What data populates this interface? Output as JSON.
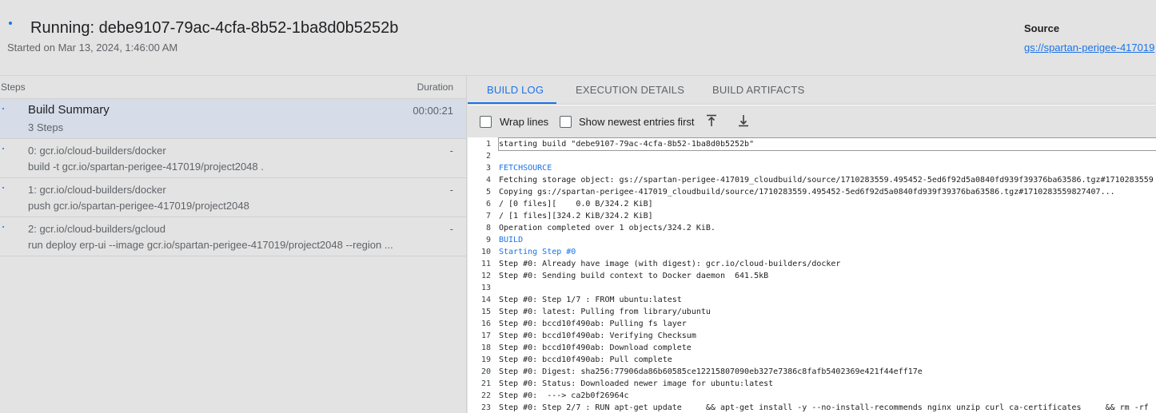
{
  "header": {
    "title": "Running: debe9107-79ac-4cfa-8b52-1ba8d0b5252b",
    "started": "Started on Mar 13, 2024, 1:46:00 AM",
    "source_label": "Source",
    "source_link": "gs://spartan-perigee-417019"
  },
  "steps": {
    "col_steps": "Steps",
    "col_duration": "Duration",
    "summary": {
      "title": "Build Summary",
      "subtitle": "3 Steps",
      "duration": "00:00:21"
    },
    "items": [
      {
        "title": "0: gcr.io/cloud-builders/docker",
        "subtitle": "build -t gcr.io/spartan-perigee-417019/project2048 .",
        "duration": "-"
      },
      {
        "title": "1: gcr.io/cloud-builders/docker",
        "subtitle": "push gcr.io/spartan-perigee-417019/project2048",
        "duration": "-"
      },
      {
        "title": "2: gcr.io/cloud-builders/gcloud",
        "subtitle": "run deploy erp-ui --image gcr.io/spartan-perigee-417019/project2048 --region ...",
        "duration": "-"
      }
    ]
  },
  "tabs": [
    {
      "label": "BUILD LOG",
      "active": true
    },
    {
      "label": "EXECUTION DETAILS",
      "active": false
    },
    {
      "label": "BUILD ARTIFACTS",
      "active": false
    }
  ],
  "toolbar": {
    "wrap_lines": "Wrap lines",
    "show_newest": "Show newest entries first",
    "scroll_top_icon": "scroll-to-top-icon",
    "scroll_bottom_icon": "scroll-to-bottom-icon"
  },
  "accent_color": "#1a73e8",
  "log_lines": [
    {
      "n": "1",
      "t": "starting build \"debe9107-79ac-4cfa-8b52-1ba8d0b5252b\""
    },
    {
      "n": "2",
      "t": ""
    },
    {
      "n": "3",
      "t": "FETCHSOURCE",
      "hl": true
    },
    {
      "n": "4",
      "t": "Fetching storage object: gs://spartan-perigee-417019_cloudbuild/source/1710283559.495452-5ed6f92d5a0840fd939f39376ba63586.tgz#1710283559"
    },
    {
      "n": "5",
      "t": "Copying gs://spartan-perigee-417019_cloudbuild/source/1710283559.495452-5ed6f92d5a0840fd939f39376ba63586.tgz#1710283559827407..."
    },
    {
      "n": "6",
      "t": "/ [0 files][    0.0 B/324.2 KiB]"
    },
    {
      "n": "7",
      "t": "/ [1 files][324.2 KiB/324.2 KiB]"
    },
    {
      "n": "8",
      "t": "Operation completed over 1 objects/324.2 KiB."
    },
    {
      "n": "9",
      "t": "BUILD",
      "hl": true
    },
    {
      "n": "10",
      "t": "Starting Step #0",
      "hl": true
    },
    {
      "n": "11",
      "t": "Step #0: Already have image (with digest): gcr.io/cloud-builders/docker"
    },
    {
      "n": "12",
      "t": "Step #0: Sending build context to Docker daemon  641.5kB"
    },
    {
      "n": "13",
      "t": ""
    },
    {
      "n": "14",
      "t": "Step #0: Step 1/7 : FROM ubuntu:latest"
    },
    {
      "n": "15",
      "t": "Step #0: latest: Pulling from library/ubuntu"
    },
    {
      "n": "16",
      "t": "Step #0: bccd10f490ab: Pulling fs layer"
    },
    {
      "n": "17",
      "t": "Step #0: bccd10f490ab: Verifying Checksum"
    },
    {
      "n": "18",
      "t": "Step #0: bccd10f490ab: Download complete"
    },
    {
      "n": "19",
      "t": "Step #0: bccd10f490ab: Pull complete"
    },
    {
      "n": "20",
      "t": "Step #0: Digest: sha256:77906da86b60585ce12215807090eb327e7386c8fafb5402369e421f44eff17e"
    },
    {
      "n": "21",
      "t": "Step #0: Status: Downloaded newer image for ubuntu:latest"
    },
    {
      "n": "22",
      "t": "Step #0:  ---> ca2b0f26964c"
    },
    {
      "n": "23",
      "t": "Step #0: Step 2/7 : RUN apt-get update     && apt-get install -y --no-install-recommends nginx unzip curl ca-certificates     && rm -rf"
    }
  ]
}
